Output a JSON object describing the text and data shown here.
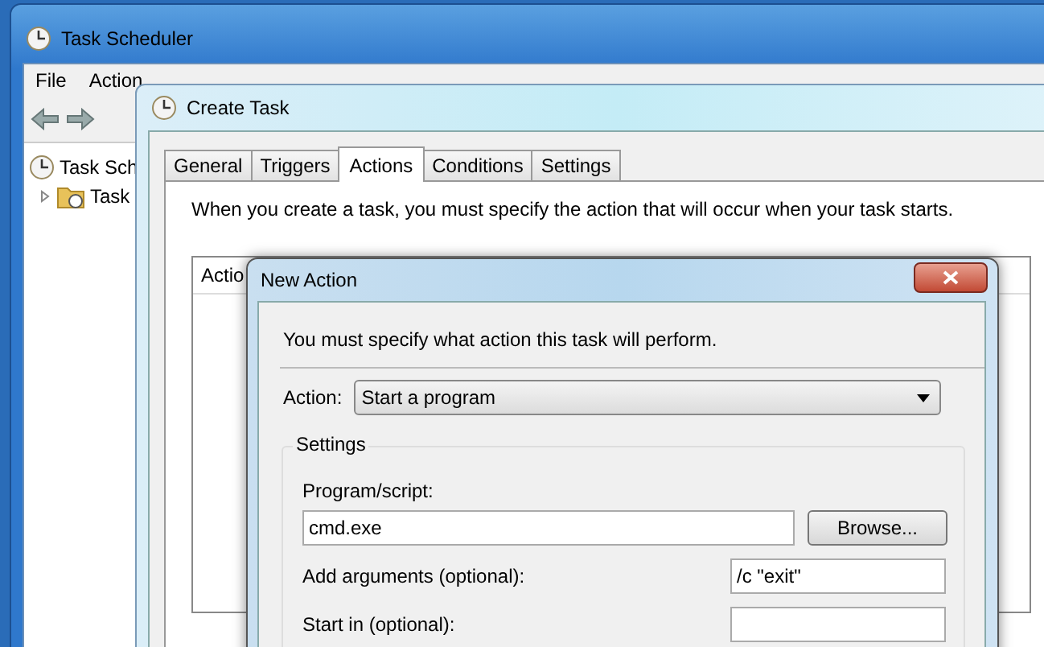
{
  "task_scheduler": {
    "title": "Task Scheduler",
    "menu": [
      "File",
      "Action"
    ],
    "tree": [
      {
        "label": "Task Sch",
        "children": [
          {
            "label": "Task",
            "expanded": false
          }
        ]
      }
    ]
  },
  "create_task": {
    "title": "Create Task",
    "tabs": [
      {
        "label": "General",
        "selected": false
      },
      {
        "label": "Triggers",
        "selected": false
      },
      {
        "label": "Actions",
        "selected": true
      },
      {
        "label": "Conditions",
        "selected": false
      },
      {
        "label": "Settings",
        "selected": false
      }
    ],
    "description": "When you create a task, you must specify the action that will occur when your task starts.",
    "list": {
      "columns": [
        "Actio"
      ]
    }
  },
  "new_action": {
    "title": "New Action",
    "message": "You must specify what action this task will perform.",
    "action": {
      "label": "Action:",
      "value": "Start a program"
    },
    "settings": {
      "title": "Settings",
      "program": {
        "label": "Program/script:",
        "value": "cmd.exe"
      },
      "browse": "Browse...",
      "arguments": {
        "label": "Add arguments (optional):",
        "value": "/c \"exit\""
      },
      "start_in": {
        "label": "Start in (optional):"
      }
    }
  }
}
